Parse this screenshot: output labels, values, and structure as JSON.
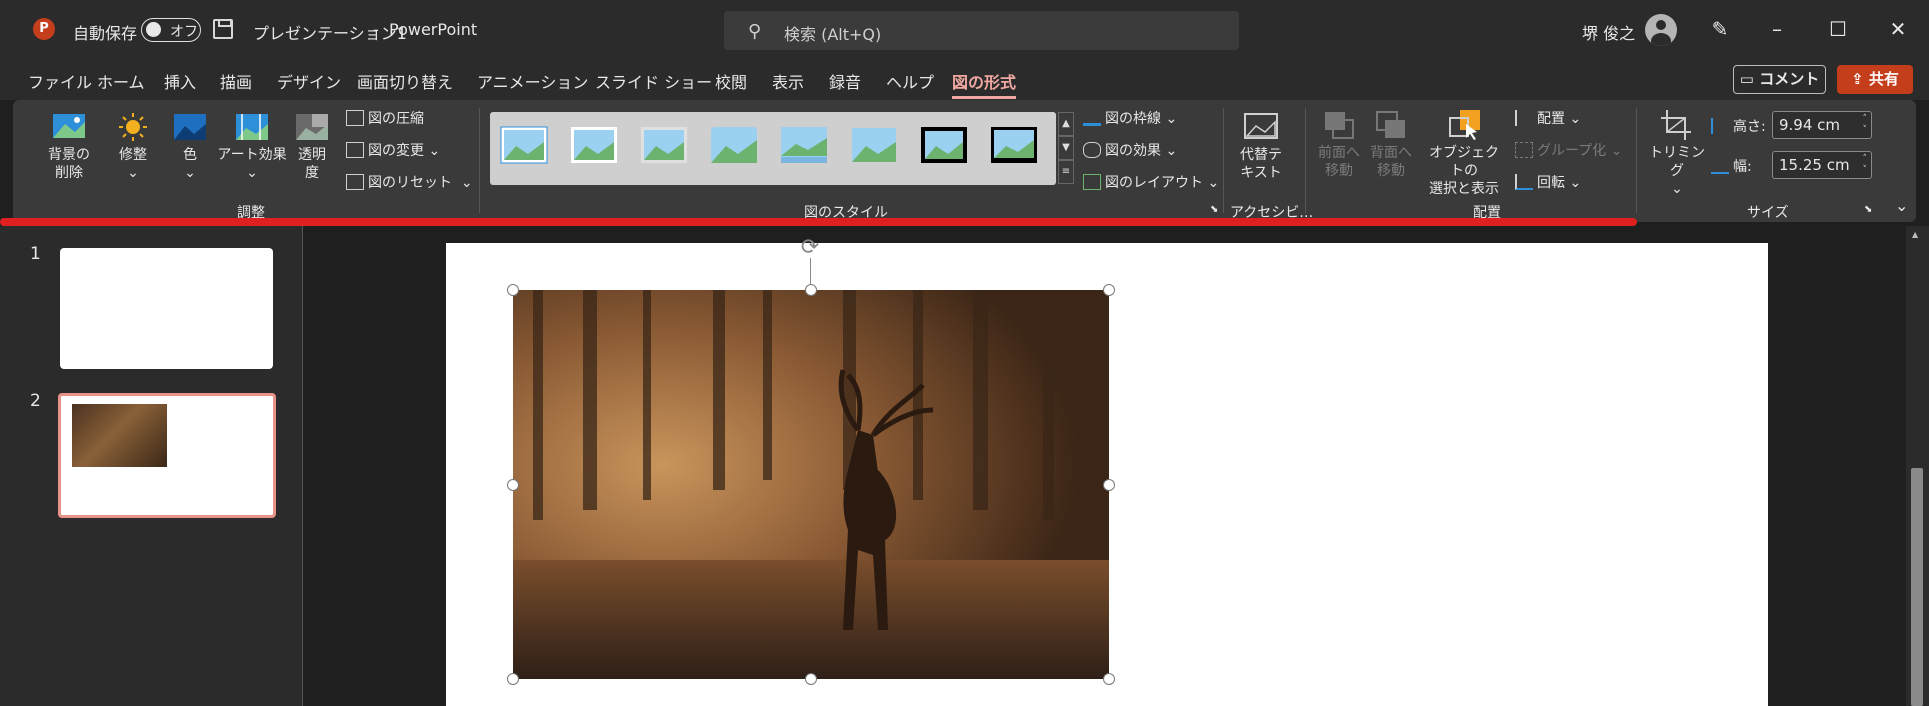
{
  "title_bar": {
    "logo_letter": "P",
    "autosave_label": "自動保存",
    "autosave_state": "オフ",
    "document_title": "プレゼンテーション1",
    "separator": "-",
    "app_name": "PowerPoint",
    "search_placeholder": "検索 (Alt+Q)",
    "user_name": "堺 俊之"
  },
  "menu": {
    "items": [
      "ファイル",
      "ホーム",
      "挿入",
      "描画",
      "デザイン",
      "画面切り替え",
      "アニメーション",
      "スライド ショー",
      "校閲",
      "表示",
      "録音",
      "ヘルプ",
      "図の形式"
    ],
    "active": "図の形式",
    "comment_label": "コメント",
    "share_label": "共有"
  },
  "ribbon": {
    "adjust": {
      "remove_bg": "背景の\n削除",
      "corrections": "修整",
      "color": "色",
      "art_effects": "アート効果",
      "transparency": "透明\n度",
      "compress": "図の圧縮",
      "change_picture": "図の変更",
      "reset_picture": "図のリセット",
      "group_label": "調整"
    },
    "styles": {
      "border": "図の枠線",
      "effects": "図の効果",
      "layout": "図のレイアウト",
      "group_label": "図のスタイル"
    },
    "accessibility": {
      "alt_text": "代替テ\nキスト",
      "group_label": "アクセシビ…"
    },
    "arrange": {
      "bring_forward": "前面へ\n移動",
      "send_backward": "背面へ\n移動",
      "selection_pane": "オブジェクトの\n選択と表示",
      "align": "配置",
      "group": "グループ化",
      "rotate": "回転",
      "group_label": "配置"
    },
    "size": {
      "crop": "トリミング",
      "height_label": "高さ:",
      "height_value": "9.94 cm",
      "width_label": "幅:",
      "width_value": "15.25 cm",
      "group_label": "サイズ"
    }
  },
  "slides": [
    {
      "number": "1"
    },
    {
      "number": "2"
    }
  ],
  "colors": {
    "accent": "#f0a8a0",
    "brand": "#c43e1c",
    "annotation_line": "#e02020"
  }
}
